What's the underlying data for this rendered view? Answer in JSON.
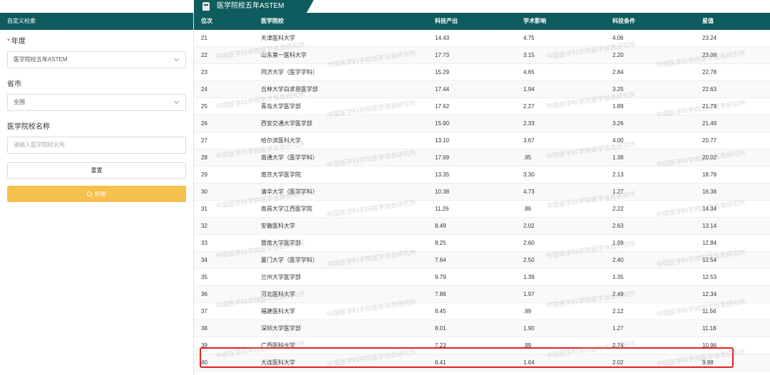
{
  "tab": {
    "title": "医学院校五年ASTEM"
  },
  "sidebar": {
    "header": "自定义检索",
    "year": {
      "label": "年度",
      "required_mark": "*",
      "value": "医学院校五年ASTEM"
    },
    "province": {
      "label": "省市",
      "value": "全国"
    },
    "school": {
      "label": "医学院校名称",
      "placeholder": "请输入医学院校名称"
    },
    "reset_label": "重置",
    "search_label": "检索"
  },
  "table": {
    "columns": [
      "位次",
      "医学院校",
      "科技产出",
      "学术影响",
      "科技条件",
      "星值"
    ],
    "rows": [
      [
        "21",
        "天津医科大学",
        "14.43",
        "4.75",
        "4.06",
        "23.24"
      ],
      [
        "22",
        "山东第一医科大学",
        "17.73",
        "3.15",
        "2.20",
        "23.08"
      ],
      [
        "23",
        "同济大学（医学学科）",
        "15.29",
        "4.65",
        "2.84",
        "22.78"
      ],
      [
        "24",
        "吉林大学白求恩医学部",
        "17.44",
        "1.94",
        "3.25",
        "22.63"
      ],
      [
        "25",
        "青岛大学医学部",
        "17.62",
        "2.27",
        "1.89",
        "21.78"
      ],
      [
        "26",
        "西安交通大学医学部",
        "15.90",
        "2.33",
        "3.26",
        "21.49"
      ],
      [
        "27",
        "哈尔滨医科大学",
        "13.10",
        "3.67",
        "4.00",
        "20.77"
      ],
      [
        "28",
        "南通大学（医学学科）",
        "17.69",
        ".95",
        "1.38",
        "20.02"
      ],
      [
        "29",
        "南京大学医学院",
        "13.35",
        "3.30",
        "2.13",
        "18.78"
      ],
      [
        "30",
        "清华大学（医学学科）",
        "10.38",
        "4.73",
        "1.27",
        "16.38"
      ],
      [
        "31",
        "南昌大学江西医学院",
        "11.26",
        ".86",
        "2.22",
        "14.34"
      ],
      [
        "32",
        "安徽医科大学",
        "8.49",
        "2.02",
        "2.63",
        "13.14"
      ],
      [
        "33",
        "暨南大学医学部",
        "8.25",
        "2.60",
        "1.99",
        "12.84"
      ],
      [
        "34",
        "厦门大学（医学学科）",
        "7.64",
        "2.50",
        "2.40",
        "12.54"
      ],
      [
        "35",
        "兰州大学医学部",
        "9.79",
        "1.39",
        "1.35",
        "12.53"
      ],
      [
        "36",
        "河北医科大学",
        "7.88",
        "1.97",
        "2.49",
        "12.34"
      ],
      [
        "37",
        "福建医科大学",
        "8.45",
        ".99",
        "2.12",
        "11.56"
      ],
      [
        "38",
        "深圳大学医学部",
        "8.01",
        "1.90",
        "1.27",
        "11.18"
      ],
      [
        "39",
        "广西医科大学",
        "7.23",
        ".99",
        "2.74",
        "10.96"
      ],
      [
        "40",
        "大连医科大学",
        "6.41",
        "1.64",
        "2.02",
        "9.98"
      ]
    ]
  },
  "watermark": "中国医学科学院医学信息研究所",
  "colors": {
    "header_bg": "#0f5c5e",
    "search_button": "#f6c04c",
    "highlight": "#e02020"
  }
}
